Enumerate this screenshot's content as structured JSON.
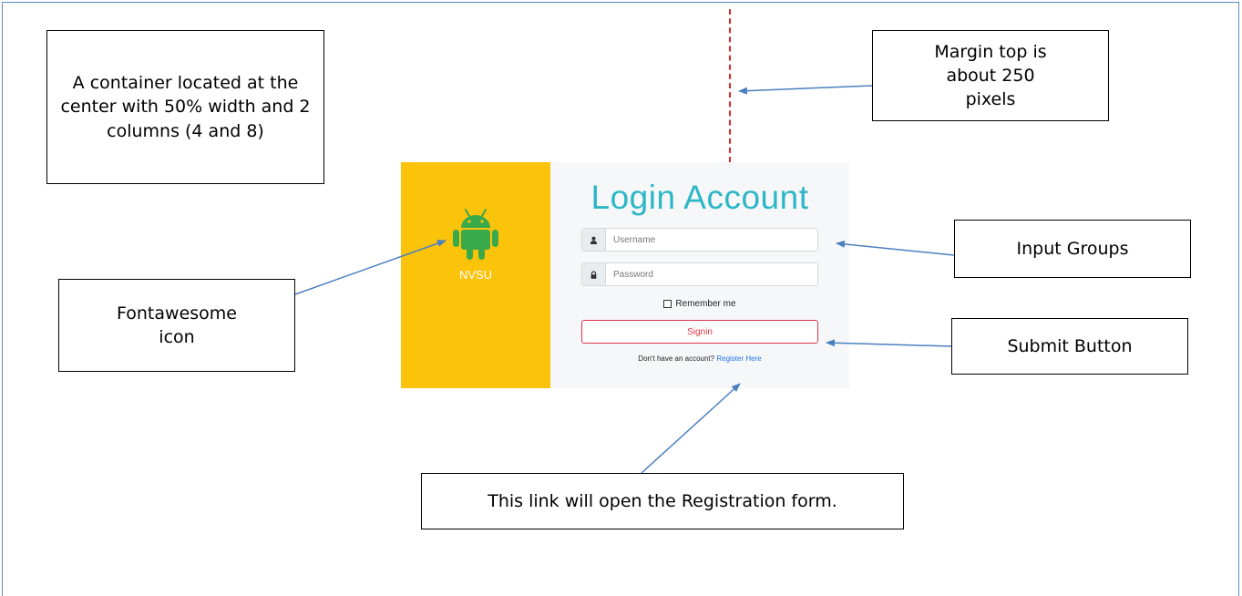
{
  "annotations": {
    "container": "A container located at the center with 50% width and 2 columns (4 and 8)",
    "margin_top": "Margin top is about 250 pixels",
    "input_groups": "Input Groups",
    "icon": "Fontawesome icon",
    "submit": "Submit Button",
    "link": "This link will open the Registration form."
  },
  "login": {
    "brand": "NVSU",
    "title": "Login Account",
    "username_placeholder": "Username",
    "password_placeholder": "Password",
    "remember_label": "Remember me",
    "signin_label": "Signin",
    "register_prompt": "Don't have an account?",
    "register_link": "Register Here"
  },
  "colors": {
    "left_panel": "#fcc30b",
    "android_icon": "#3aa949",
    "title": "#2db6c8",
    "signin": "#dc3545",
    "arrow": "#4a7fc0",
    "margin_line": "#e52521"
  },
  "icons": {
    "brand": "android-icon",
    "username": "user-icon",
    "password": "lock-icon"
  }
}
